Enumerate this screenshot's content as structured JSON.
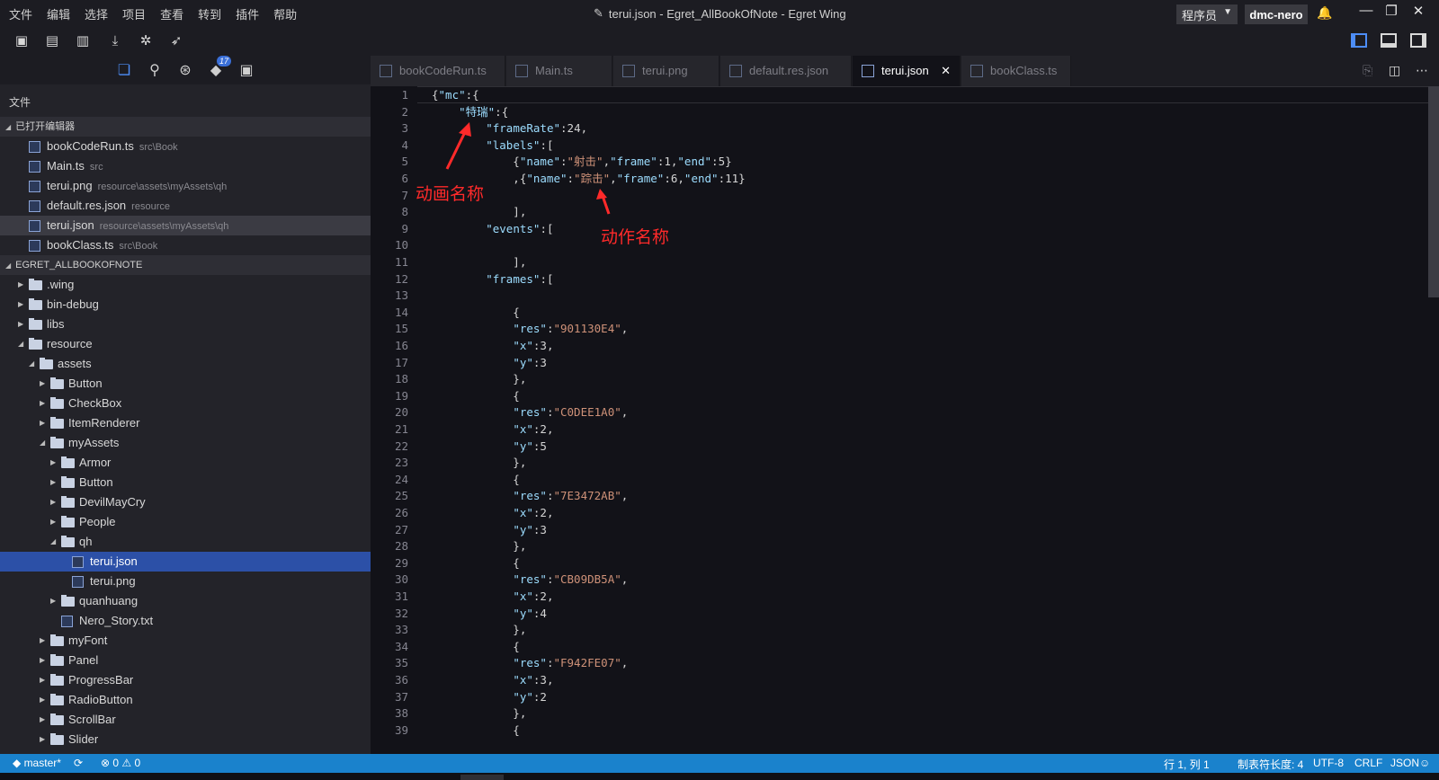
{
  "menu": [
    "文件",
    "编辑",
    "选择",
    "项目",
    "查看",
    "转到",
    "插件",
    "帮助"
  ],
  "window_title": "terui.json - Egret_AllBookOfNote - Egret Wing",
  "role_select": "程序员",
  "user_name": "dmc-nero",
  "side_icon_badge": "17",
  "sidebar": {
    "label": "文件",
    "open_editors_title": "已打开编辑器",
    "open_editors": [
      {
        "name": "bookCodeRun.ts",
        "path": "src\\Book"
      },
      {
        "name": "Main.ts",
        "path": "src"
      },
      {
        "name": "terui.png",
        "path": "resource\\assets\\myAssets\\qh"
      },
      {
        "name": "default.res.json",
        "path": "resource"
      },
      {
        "name": "terui.json",
        "path": "resource\\assets\\myAssets\\qh"
      },
      {
        "name": "bookClass.ts",
        "path": "src\\Book"
      }
    ],
    "project_title": "EGRET_ALLBOOKOFNOTE",
    "tree": [
      {
        "name": ".wing"
      },
      {
        "name": "bin-debug"
      },
      {
        "name": "libs"
      },
      {
        "name": "resource"
      },
      {
        "name": "assets"
      },
      {
        "name": "Button"
      },
      {
        "name": "CheckBox"
      },
      {
        "name": "ItemRenderer"
      },
      {
        "name": "myAssets"
      },
      {
        "name": "Armor"
      },
      {
        "name": "Button"
      },
      {
        "name": "DevilMayCry"
      },
      {
        "name": "People"
      },
      {
        "name": "qh"
      },
      {
        "name": "terui.json"
      },
      {
        "name": "terui.png"
      },
      {
        "name": "quanhuang"
      },
      {
        "name": "Nero_Story.txt"
      },
      {
        "name": "myFont"
      },
      {
        "name": "Panel"
      },
      {
        "name": "ProgressBar"
      },
      {
        "name": "RadioButton"
      },
      {
        "name": "ScrollBar"
      },
      {
        "name": "Slider"
      }
    ]
  },
  "tabs": [
    {
      "label": "bookCodeRun.ts"
    },
    {
      "label": "Main.ts"
    },
    {
      "label": "terui.png"
    },
    {
      "label": "default.res.json"
    },
    {
      "label": "terui.json"
    },
    {
      "label": "bookClass.ts"
    }
  ],
  "code_lines": [
    "{\"mc\":{",
    "    \"特瑞\":{",
    "        \"frameRate\":24,",
    "        \"labels\":[",
    "            {\"name\":\"射击\",\"frame\":1,\"end\":5}",
    "            ,{\"name\":\"踪击\",\"frame\":6,\"end\":11}",
    "",
    "            ],",
    "        \"events\":[",
    "",
    "            ],",
    "        \"frames\":[",
    "",
    "            {",
    "            \"res\":\"901130E4\",",
    "            \"x\":3,",
    "            \"y\":3",
    "            },",
    "            {",
    "            \"res\":\"C0DEE1A0\",",
    "            \"x\":2,",
    "            \"y\":5",
    "            },",
    "            {",
    "            \"res\":\"7E3472AB\",",
    "            \"x\":2,",
    "            \"y\":3",
    "            },",
    "            {",
    "            \"res\":\"CB09DB5A\",",
    "            \"x\":2,",
    "            \"y\":4",
    "            },",
    "            {",
    "            \"res\":\"F942FE07\",",
    "            \"x\":3,",
    "            \"y\":2",
    "            },",
    "            {"
  ],
  "annotations": {
    "animation_name": "动画名称",
    "action_name": "动作名称"
  },
  "status": {
    "branch": "master*",
    "errors": "0",
    "warnings": "0",
    "position": "行 1, 列 1",
    "tab_size": "制表符长度: 4",
    "encoding": "UTF-8",
    "eol": "CRLF",
    "language": "JSON"
  },
  "colors": {
    "accent": "#2c50a7",
    "status_bar": "#1a82cc",
    "annotation": "#ff2a2a"
  }
}
